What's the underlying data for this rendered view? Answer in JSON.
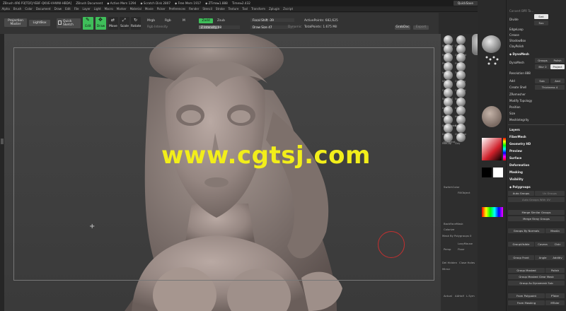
{
  "titlebar": {
    "app": "ZBrush 4R6 P3[TDFJ-YEBF-QKVE-VHWW-HBDA]",
    "doc": "ZBrush Document",
    "active_mem": "◆ Active Mem 1294",
    "scratch": "◆ Scratch Disk 2807",
    "free_mem": "◆ Free Mem 1917",
    "ztime": "◆ ZTime▸1.888",
    "timer": "Timer▸2.432",
    "quicksave": "QuickSave",
    "seethrough": "See-through  0",
    "seethrough_value": 0.0,
    "menus": "Menus",
    "script": "DefaultZScript"
  },
  "menubar": [
    "Alpha",
    "Brush",
    "Color",
    "Document",
    "Draw",
    "Edit",
    "File",
    "Layer",
    "Light",
    "Macro",
    "Marker",
    "Material",
    "Movie",
    "Picker",
    "Preferences",
    "Render",
    "Stencil",
    "Stroke",
    "Texture",
    "Tool",
    "Transform",
    "Zplugin",
    "Zscript"
  ],
  "toolbar": {
    "projection_master": "Projection Master",
    "lightbox": "LightBox",
    "quick_sketch": "Quick Sketch",
    "edit": "Edit",
    "draw": "Draw",
    "move": "Move",
    "scale": "Scale",
    "rotate": "Rotate",
    "mrgb": "Mrgb",
    "rgb": "Rgb",
    "m": "M",
    "rgb_intensity": "Rgb Intensity",
    "zadd": "Zadd",
    "zsub": "Zsub",
    "z_intensity": "Z Intensity 48",
    "z_intensity_value": 48,
    "focal_shift": "Focal Shift -39",
    "draw_size": "Draw Size 47",
    "dynamic": "Dynamic",
    "active_points": "ActivePoints: 682,625",
    "total_points": "TotalPoints: 1.675 Mil",
    "grabdoc": "GrabDoc",
    "export": "Export"
  },
  "viewport": {
    "watermark": "www.cgtsj.com",
    "frame_color": "#777777",
    "watermark_color": "#f2ee1a",
    "cursor_color": "#c43030"
  },
  "shelf": {
    "brushes": [
      {
        "label": "Standard"
      },
      {
        "label": "ClayTub"
      },
      {
        "label": "Move"
      },
      {
        "label": "ClayBuild"
      },
      {
        "label": "Pinch"
      },
      {
        "label": "Flatten"
      },
      {
        "label": "Inflat"
      },
      {
        "label": "TrimDyn"
      },
      {
        "label": "hPolish"
      },
      {
        "label": "Orb_Clay"
      },
      {
        "label": "Orb_Cra"
      },
      {
        "label": "Orb_Flatt"
      },
      {
        "label": "SmoothS"
      },
      {
        "label": "Smooth"
      },
      {
        "label": "msh_WF"
      },
      {
        "label": "SS_Cre"
      },
      {
        "label": "dt_sub"
      },
      {
        "label": "Hair"
      },
      {
        "label": "SkinShade4"
      },
      {
        "label": "Basic"
      },
      {
        "label": "DotsDot"
      },
      {
        "label": "ChrCurve"
      },
      {
        "label": "MatCap"
      },
      {
        "label": "Clay"
      }
    ],
    "gradient": "Gradient",
    "switch_color": "SwitchColor",
    "fill_object": "FillObject",
    "backface_mask": "BackFaceMask",
    "colorize": "Colorize",
    "mask_by_polygroups": "Mask By Polygroups 0",
    "persp": "Persp",
    "floor": "Floor",
    "lazymouse": "LazyMouse",
    "del_hidden": "Del Hidden",
    "close_holes": "Close Holes",
    "mirror": "Mirror",
    "actual": "Actual",
    "aahalf": "AAHalf",
    "frame": "Frame",
    "lsym": "L.Sym",
    "solo": "Solo",
    "accent_color": "#35a653",
    "picker_hue": "#d0202a"
  },
  "palette": {
    "items": [
      "ZoomAll",
      "Scroll",
      "Zoom",
      "Actual",
      "AAHalf",
      "Dynamic",
      "Persp",
      "Floor",
      "Local",
      "LSym",
      "Xyz",
      "Frame",
      "Move",
      "Scale",
      "Rotate",
      "Line Fill",
      "PolyF",
      "Transp",
      "Ghost",
      "Solo",
      "Xpose"
    ]
  },
  "rpanel": {
    "label_top": "Convert BPR To...",
    "divide": "Divide",
    "smt": "Smt",
    "suv": "Suv",
    "edgeloop": "EdgeLoop",
    "crease": "Crease",
    "shadowbox": "ShadowBox",
    "claypolish": "ClayPolish",
    "dynamesh_hdr": "◆ DynaMesh",
    "dynamesh": "DynaMesh",
    "groups": "Groups",
    "polish": "Polish",
    "blur": "Blur 2",
    "project": "Project",
    "resolution": "Resolution 888",
    "add": "Add",
    "sub": "Sub",
    "and": "And",
    "create_shell": "Create Shell",
    "thickness": "Thickness 4",
    "zremesher": "ZRemesher",
    "modify_topology": "Modify Topology",
    "position": "Position",
    "size": "Size",
    "meshintegrity": "MeshIntegrity",
    "layers": "Layers",
    "fibermesh": "FiberMesh",
    "geometry_hd": "Geometry HD",
    "preview": "Preview",
    "surface": "Surface",
    "deformation": "Deformation",
    "masking": "Masking",
    "visibility": "Visibility",
    "polygroups": "◆ Polygroups",
    "auto_groups": "Auto Groups",
    "uv_groups": "Uv Groups",
    "auto_groups_uv": "Auto Groups With UV",
    "merge_similar": "Merge Similar Groups",
    "merge_stray": "Merge Stray Groups",
    "groups_by_normals": "Groups By Normals",
    "maxang": "MaxAn",
    "group_visible": "GroupVisible",
    "coverage": "Covera",
    "clstr": "Clstr",
    "group_front": "Group Front",
    "angle": "Angle",
    "additive": "Additiv",
    "group_masked": "Group Masked",
    "polish2": "Polish",
    "group_masked_clear": "Group Masked Clear Mask",
    "group_as_dynamesh": "Group As Dynamesh Sub",
    "from_polypaint": "From Polypaint",
    "ptoler": "PToler",
    "from_masking": "From Masking",
    "mtoler": "MToler"
  }
}
